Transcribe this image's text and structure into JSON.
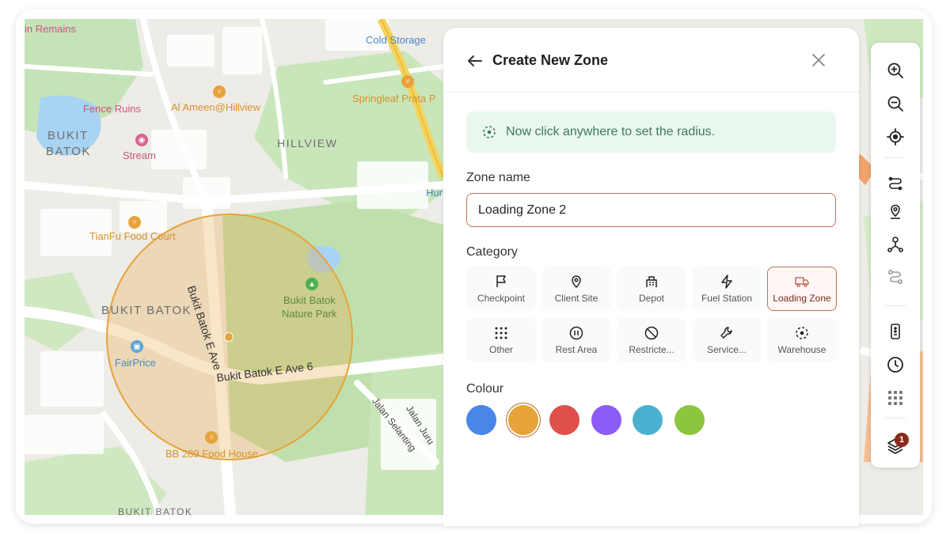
{
  "map": {
    "labels": {
      "ruins_top": "in Remains",
      "cold_storage": "Cold Storage",
      "fence_ruins": "Fence Ruins",
      "al_ameen": "Al Ameen@Hillview",
      "springleaf": "Springleaf Prata P",
      "bukit": "BUKIT",
      "batok": "BATOK",
      "stream": "Stream",
      "hillview": "HILLVIEW",
      "hum": "Hur",
      "tianfu": "TianFu Food Court",
      "bukit_batok_area": "BUKIT BATOK",
      "nature_park_1": "Bukit Batok",
      "nature_park_2": "Nature Park",
      "fairprice": "FairPrice",
      "road_vertical": "Bukit Batok E Ave",
      "road_horizontal": "Bukit Batok E Ave 6",
      "jalan_selanting": "Jalan Selanting",
      "jalan_jurong": "Jalan Juru",
      "bb_food_house": "BB 289 Food House",
      "bukit_batok_bottom": "BUKIT BATOK"
    },
    "zone_circle_color": "#e8a23a"
  },
  "panel": {
    "title": "Create New Zone",
    "info_text": "Now click anywhere to set the radius.",
    "zone_name_label": "Zone name",
    "zone_name_value": "Loading Zone 2",
    "category_label": "Category",
    "categories": [
      {
        "label": "Checkpoint",
        "icon": "flag-icon"
      },
      {
        "label": "Client Site",
        "icon": "map-pin-icon"
      },
      {
        "label": "Depot",
        "icon": "building-icon"
      },
      {
        "label": "Fuel Station",
        "icon": "lightning-icon"
      },
      {
        "label": "Loading Zone",
        "icon": "truck-icon"
      },
      {
        "label": "Other",
        "icon": "grid-dots-icon"
      },
      {
        "label": "Rest Area",
        "icon": "pause-circle-icon"
      },
      {
        "label": "Restricte...",
        "icon": "ban-icon"
      },
      {
        "label": "Service...",
        "icon": "wrench-icon"
      },
      {
        "label": "Warehouse",
        "icon": "dashed-circle-icon"
      }
    ],
    "selected_category": "Loading Zone",
    "colour_label": "Colour",
    "colours": [
      "#4a86e8",
      "#e8a23a",
      "#e0504a",
      "#8b5cf6",
      "#4bb0d0",
      "#8cc63f"
    ],
    "selected_colour": "#e8a23a",
    "accent": "#c76b5c"
  },
  "toolbar": {
    "buttons": [
      "zoom-in-icon",
      "zoom-out-icon",
      "locate-icon",
      "route-icon",
      "map-pin-icon",
      "network-icon",
      "path-icon",
      "device-icon",
      "clock-icon",
      "apps-grid-icon",
      "layers-icon"
    ],
    "layers_badge": "1"
  }
}
